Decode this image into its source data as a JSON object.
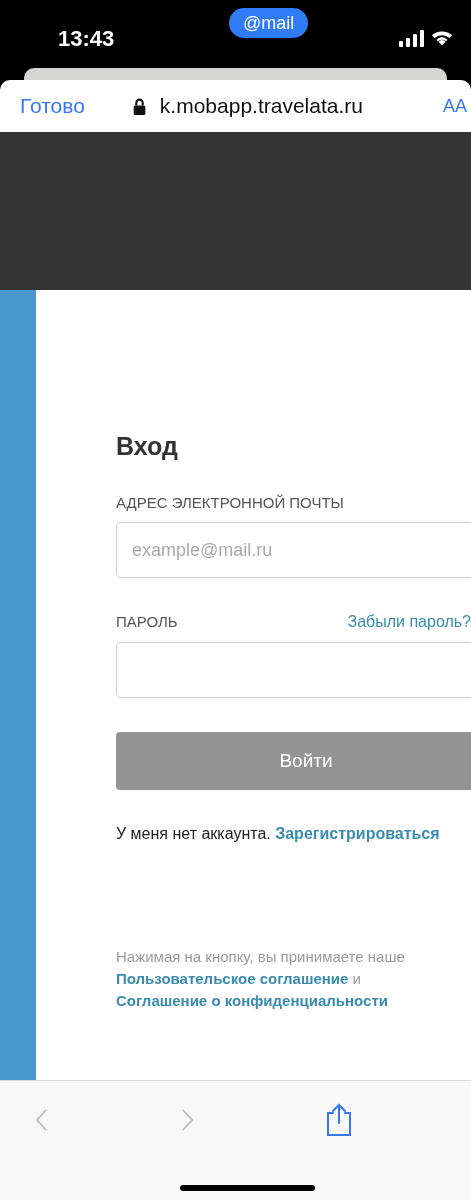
{
  "status_bar": {
    "time": "13:43",
    "app_pill": "@mail"
  },
  "browser": {
    "done": "Готово",
    "url": "k.mobapp.travelata.ru",
    "text_size": "AA"
  },
  "form": {
    "title": "Вход",
    "email": {
      "label": "АДРЕС ЭЛЕКТРОННОЙ ПОЧТЫ",
      "placeholder": "example@mail.ru"
    },
    "password": {
      "label": "ПАРОЛЬ",
      "forgot": "Забыли пароль?"
    },
    "submit": {
      "label": "Войти",
      "disabled": true
    },
    "signup": {
      "text": "У меня нет аккаунта.",
      "link": "Зарегистрироваться"
    },
    "terms": {
      "text": "Нажимая на кнопку, вы принимаете наше",
      "link_1": "Пользовательское соглашение",
      "joiner": "и",
      "link_2": "Соглашение о конфиденциальности"
    }
  },
  "toolbar": [
    {
      "kind": "back",
      "disabled": true
    },
    {
      "kind": "forward",
      "disabled": true
    },
    {
      "kind": "share",
      "disabled": false
    }
  ]
}
